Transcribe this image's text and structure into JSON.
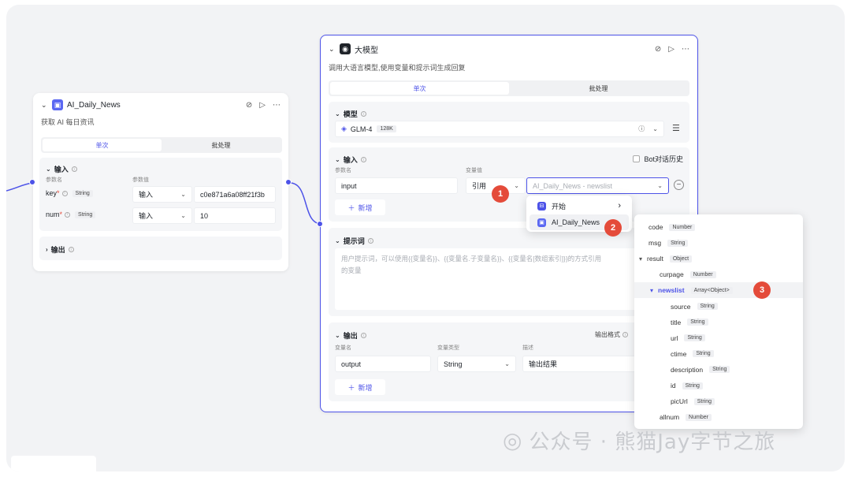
{
  "left_node": {
    "title": "AI_Daily_News",
    "description": "获取 AI 每日资讯",
    "tabs": [
      "单次",
      "批处理"
    ],
    "input_section": {
      "title": "输入",
      "col_name": "参数名",
      "col_value": "参数值",
      "rows": [
        {
          "name": "key",
          "type": "String",
          "mode": "输入",
          "value": "c0e871a6a08ff21f3b"
        },
        {
          "name": "num",
          "type": "String",
          "mode": "输入",
          "value": "10"
        }
      ]
    },
    "output_section": {
      "title": "输出"
    }
  },
  "llm_node": {
    "title": "大模型",
    "description": "调用大语言模型,使用变量和提示词生成回复",
    "tabs": [
      "单次",
      "批处理"
    ],
    "model_section": {
      "title": "模型",
      "model_name": "GLM-4",
      "model_badge": "128K"
    },
    "input_section": {
      "title": "输入",
      "bot_history": "Bot对话历史",
      "col_name": "参数名",
      "col_value": "变量值",
      "row": {
        "name": "input",
        "mode": "引用",
        "ref_placeholder": "AI_Daily_News - newslist"
      },
      "add_label": "新增"
    },
    "prompt_section": {
      "title": "提示词",
      "placeholder_line1": "用户提示词，可以使用{{变量名}}、{{变量名.子变量名}}、{{变量名[数组索引]}}的方式引用",
      "placeholder_line2": "的变量"
    },
    "output_section": {
      "title": "输出",
      "format_label": "输出格式",
      "col_name": "变量名",
      "col_type": "变量类型",
      "col_desc": "描述",
      "row": {
        "name": "output",
        "type": "String",
        "desc": "输出结果"
      },
      "add_label": "新增"
    }
  },
  "ref_menu": {
    "items": [
      {
        "label": "开始"
      },
      {
        "label": "AI_Daily_News"
      }
    ]
  },
  "var_tree": {
    "rows": [
      {
        "name": "code",
        "type": "Number",
        "indent": 0,
        "arrow": ""
      },
      {
        "name": "msg",
        "type": "String",
        "indent": 0,
        "arrow": ""
      },
      {
        "name": "result",
        "type": "Object",
        "indent": 0,
        "arrow": "▾"
      },
      {
        "name": "curpage",
        "type": "Number",
        "indent": 1,
        "arrow": ""
      },
      {
        "name": "newslist",
        "type": "Array<Object>",
        "indent": 1,
        "arrow": "▾",
        "selected": true
      },
      {
        "name": "source",
        "type": "String",
        "indent": 2,
        "arrow": ""
      },
      {
        "name": "title",
        "type": "String",
        "indent": 2,
        "arrow": ""
      },
      {
        "name": "url",
        "type": "String",
        "indent": 2,
        "arrow": ""
      },
      {
        "name": "ctime",
        "type": "String",
        "indent": 2,
        "arrow": ""
      },
      {
        "name": "description",
        "type": "String",
        "indent": 2,
        "arrow": ""
      },
      {
        "name": "id",
        "type": "String",
        "indent": 2,
        "arrow": ""
      },
      {
        "name": "picUrl",
        "type": "String",
        "indent": 2,
        "arrow": ""
      },
      {
        "name": "allnum",
        "type": "Number",
        "indent": 1,
        "arrow": ""
      }
    ]
  },
  "callouts": [
    "1",
    "2",
    "3"
  ],
  "watermark": "公众号 · 熊猫Jay字节之旅",
  "colors": {
    "accent": "#4d53e8",
    "callout": "#e44b3a",
    "canvas": "#f2f3f5"
  }
}
